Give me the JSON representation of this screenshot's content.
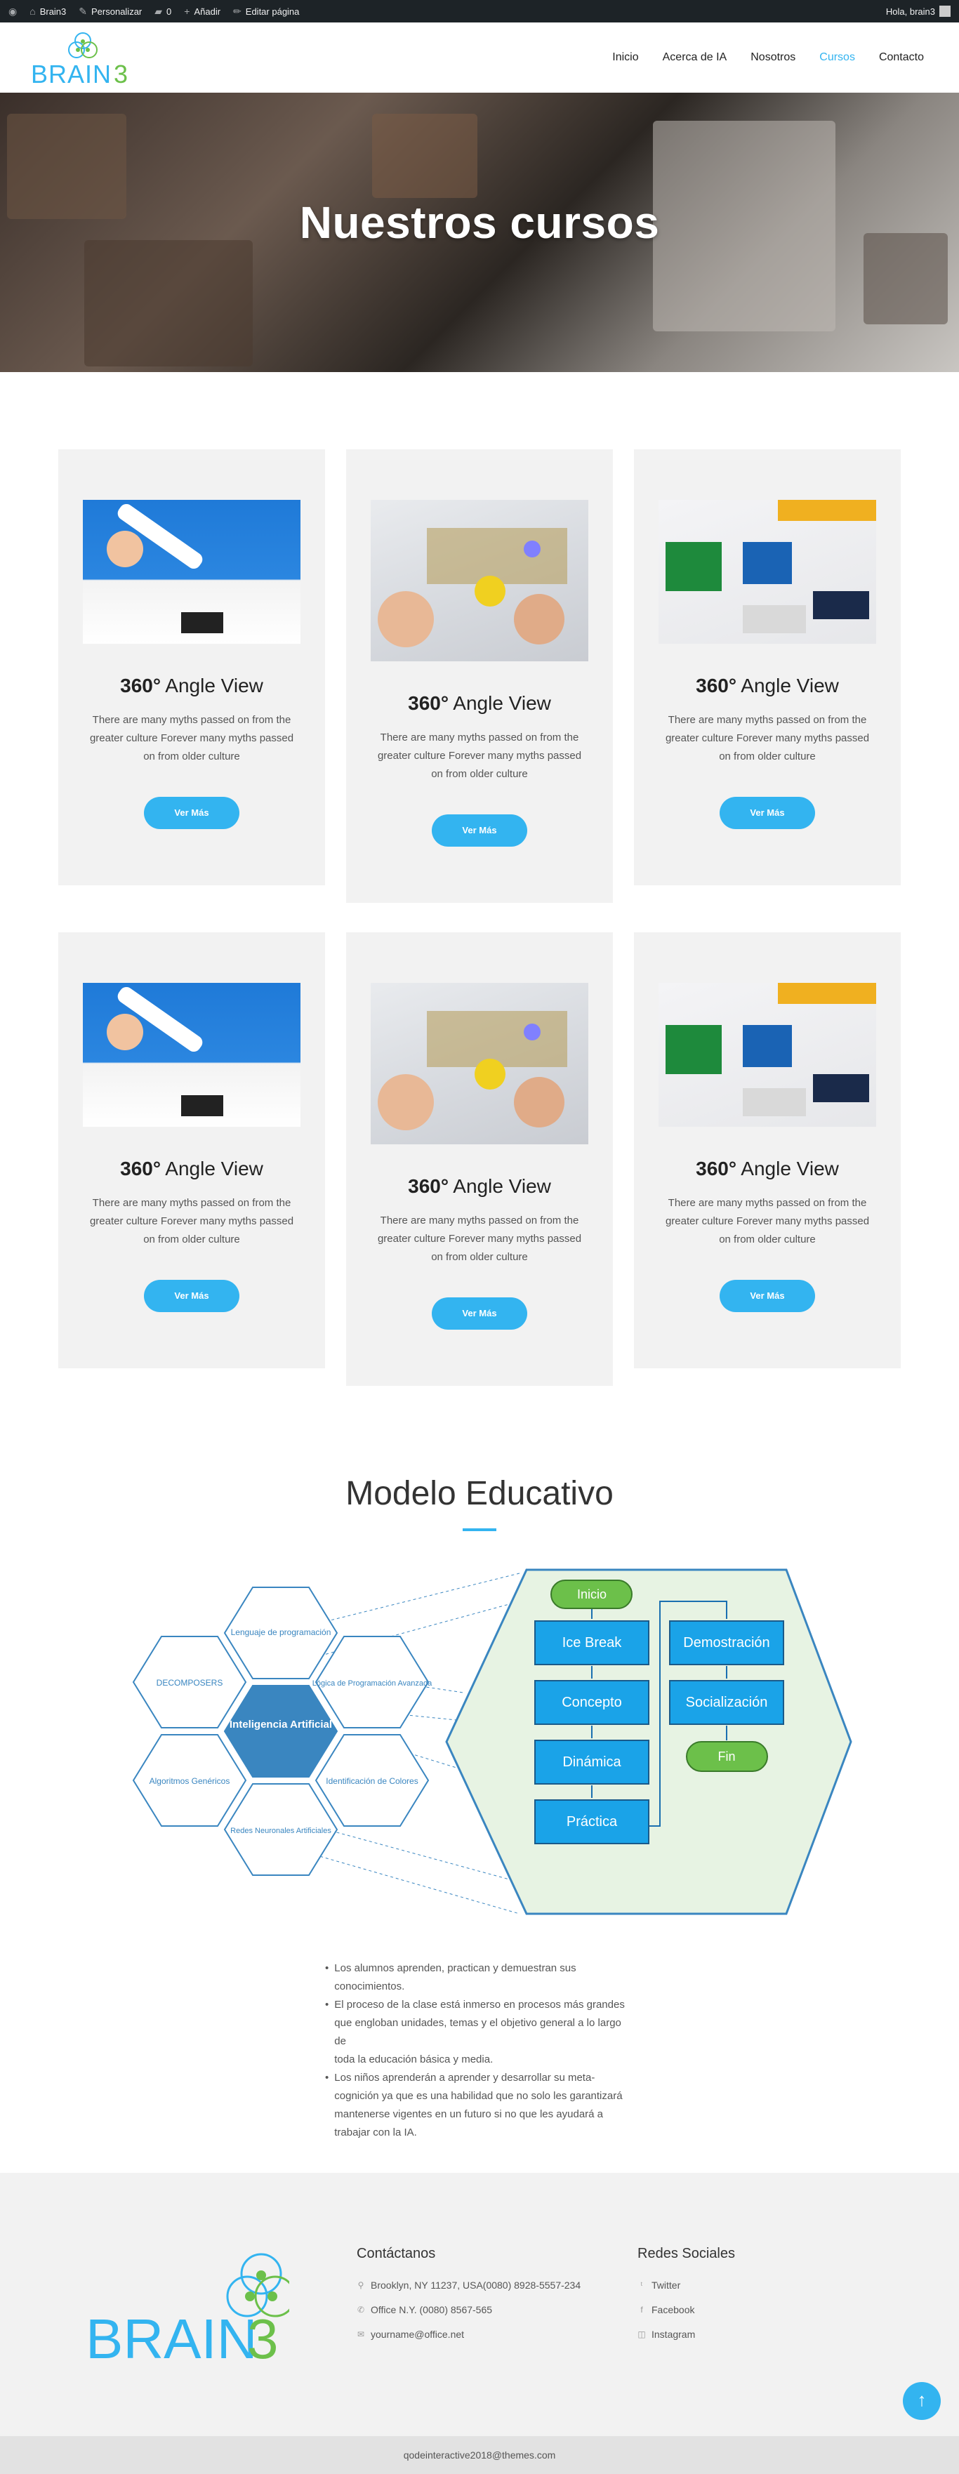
{
  "adminbar": {
    "site": "Brain3",
    "customize": "Personalizar",
    "comments_count": "0",
    "add": "Añadir",
    "edit": "Editar página",
    "greeting": "Hola, brain3"
  },
  "nav": {
    "items": [
      "Inicio",
      "Acerca de IA",
      "Nosotros",
      "Cursos",
      "Contacto"
    ],
    "active": "Cursos"
  },
  "logo_text": "BRAIN3",
  "hero": {
    "title": "Nuestros cursos"
  },
  "courses": [
    {
      "title_bold": "360°",
      "title_rest": " Angle View",
      "text": "There are many myths passed on from the greater culture Forever many myths passed on from older culture",
      "button": "Ver Más"
    },
    {
      "title_bold": "360°",
      "title_rest": " Angle View",
      "text": "There are many myths passed on from the greater culture Forever many myths passed on from older culture",
      "button": "Ver Más"
    },
    {
      "title_bold": "360°",
      "title_rest": " Angle View",
      "text": "There are many myths passed on from the greater culture Forever many myths passed on from older culture",
      "button": "Ver Más"
    },
    {
      "title_bold": "360°",
      "title_rest": " Angle View",
      "text": "There are many myths passed on from the greater culture Forever many myths passed on from older culture",
      "button": "Ver Más"
    },
    {
      "title_bold": "360°",
      "title_rest": " Angle View",
      "text": "There are many myths passed on from the greater culture Forever many myths passed on from older culture",
      "button": "Ver Más"
    },
    {
      "title_bold": "360°",
      "title_rest": " Angle View",
      "text": "There are many myths passed on from the greater culture Forever many myths passed on from older culture",
      "button": "Ver Más"
    }
  ],
  "modelo": {
    "title": "Modelo Educativo",
    "hexes": {
      "center": "Inteligencia Artificial",
      "top": "Lenguaje de programación",
      "left": "DECOMPOSERS",
      "right": "Lógica de Programación Avanzada",
      "bottom_left": "Algoritmos Genéricos",
      "bottom_right": "Identificación de Colores",
      "bottom": "Redes Neuronales Artificiales"
    },
    "flow": {
      "start": "Inicio",
      "left_steps": [
        "Ice Break",
        "Concepto",
        "Dinámica",
        "Práctica"
      ],
      "right_steps": [
        "Demostración",
        "Socialización"
      ],
      "end": "Fin"
    },
    "bullets": [
      "Los alumnos aprenden, practican y demuestran sus conocimientos.",
      "El proceso de la clase está inmerso en procesos más grandes que engloban unidades, temas y el objetivo general a lo largo de\ntoda la educación básica y media.",
      "Los niños aprenderán a aprender y desarrollar su meta-cognición ya que es una habilidad que no solo les garantizará mantenerse vigentes en un futuro si no que les ayudará a trabajar con la IA."
    ]
  },
  "footer": {
    "contact_title": "Contáctanos",
    "address": "Brooklyn, NY 11237, USA(0080) 8928-5557-234",
    "phone": "Office N.Y. (0080) 8567-565",
    "email": "yourname@office.net",
    "social_title": "Redes Sociales",
    "social": [
      "Twitter",
      "Facebook",
      "Instagram"
    ],
    "copyright": "qodeinteractive2018@themes.com"
  },
  "colors": {
    "accent": "#33b4f0",
    "flow_box": "#1aa3e8",
    "flow_green": "#6cc04a",
    "hex_center": "#3a86c0"
  },
  "icons": {
    "wp": "wordpress-icon",
    "brush": "paintbrush-icon",
    "comment": "comment-icon",
    "plus": "plus-icon",
    "pencil": "pencil-icon",
    "pin": "location-pin-icon",
    "phone": "phone-icon",
    "mail": "mail-icon",
    "up": "arrow-up-icon"
  }
}
